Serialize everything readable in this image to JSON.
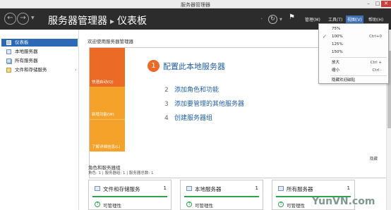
{
  "window": {
    "title": "服务器管理器"
  },
  "header": {
    "app_name": "服务器管理器",
    "separator": "▸",
    "page": "仪表板",
    "menu": {
      "manage": "管理(M)",
      "tools": "工具(T)",
      "view": "视图(V)",
      "help": "帮助(H)"
    }
  },
  "sidebar": {
    "items": [
      {
        "label": "仪表板"
      },
      {
        "label": "本地服务器"
      },
      {
        "label": "所有服务器"
      },
      {
        "label": "文件和存储服务"
      }
    ]
  },
  "welcome": {
    "title": "欢迎使用服务器管理器",
    "tiles": {
      "quick_start": "快速启动(Q)",
      "whats_new": "新增功能(W)",
      "learn_more": "了解详细信息(L)"
    },
    "step1": {
      "num": "1",
      "text": "配置此本地服务器"
    },
    "steps": [
      {
        "num": "2",
        "text": "添加角色和功能"
      },
      {
        "num": "3",
        "text": "添加要管理的其他服务器"
      },
      {
        "num": "4",
        "text": "创建服务器组"
      }
    ],
    "hide": "隐藏"
  },
  "roles": {
    "title": "角色和服务器组",
    "subtitle": "角色: 1 | 服务器组: 1 | 服务器总数: 1",
    "cards": [
      {
        "title": "文件和存储服务",
        "count": "1",
        "status": "可管理性"
      },
      {
        "title": "本地服务器",
        "count": "1",
        "status": "可管理性"
      },
      {
        "title": "所有服务器",
        "count": "1",
        "status": "可管理性"
      }
    ]
  },
  "view_menu": {
    "zoom_options": [
      "75%",
      "100%",
      "125%",
      "150%"
    ],
    "selected": "100%",
    "zoom_in": "放大",
    "zoom_in_shortcut": "Ctrl +",
    "zoom_out": "缩小",
    "zoom_out_shortcut": "Ctrl -",
    "zoom_100_shortcut": "Ctrl+0",
    "hide_welcome": "隐藏欢迎磁贴"
  },
  "watermark": "YunVN.com",
  "colors": {
    "accent": "#2b68b6",
    "quick_start": "#ea6a26",
    "tiles": "#f4a229",
    "header": "#2c2c2c",
    "healthy": "#31a24c"
  }
}
